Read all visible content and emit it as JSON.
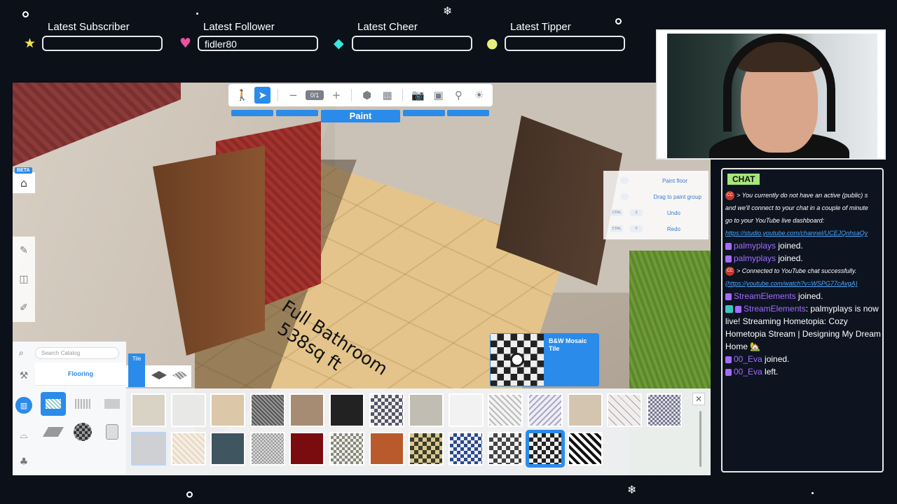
{
  "alerts": [
    {
      "label": "Latest Subscriber",
      "value": "",
      "icon": "★",
      "icon_color": "#f2e34b"
    },
    {
      "label": "Latest Follower",
      "value": "fidler80",
      "icon": "♥",
      "icon_color": "#ef4fa0"
    },
    {
      "label": "Latest Cheer",
      "value": "",
      "icon": "◆",
      "icon_color": "#39e6e0"
    },
    {
      "label": "Latest Tipper",
      "value": "",
      "icon": "●",
      "icon_color": "#e6f07a"
    }
  ],
  "game": {
    "toolbar": {
      "level": "0/1",
      "active_tab": "Paint"
    },
    "beta_badge": "BETA",
    "room_label_line1": "Full Bathroom",
    "room_label_line2": "538sq ft",
    "hotkeys": [
      {
        "keys": [
          "",
          ""
        ],
        "text": "Paint floor"
      },
      {
        "keys": [
          "",
          ""
        ],
        "text": "Drag to paint group"
      },
      {
        "keys": [
          "CTRL",
          "Z"
        ],
        "text": "Undo"
      },
      {
        "keys": [
          "CTRL",
          "Y"
        ],
        "text": "Redo"
      }
    ],
    "catalog": {
      "search_placeholder": "Search Catalog",
      "subcategory": "Flooring",
      "tile_tab": "Tile"
    },
    "selected_item": "B&W Mosaic Tile"
  },
  "chat": {
    "title": "CHAT",
    "messages": [
      {
        "type": "yt",
        "text": "> You currently do not have an active (public) s"
      },
      {
        "type": "sys",
        "text": "and we'll connect to your chat in a couple of minute"
      },
      {
        "type": "sys",
        "text": "go to your YouTube live dashboard:"
      },
      {
        "type": "link",
        "text": "https://studio.youtube.com/channel/UCEJQnhsaQy"
      },
      {
        "type": "tw",
        "user": "palmyplays",
        "text": " joined."
      },
      {
        "type": "tw",
        "user": "palmyplays",
        "text": " joined."
      },
      {
        "type": "yt",
        "text": "> Connected to YouTube chat successfully."
      },
      {
        "type": "link",
        "text": "(https://youtube.com/watch?v=WSPG77cAvgA)"
      },
      {
        "type": "tw",
        "user": "StreamElements",
        "text": " joined."
      },
      {
        "type": "se",
        "user": "StreamElements",
        "text": ": palmyplays is now live! Streaming Hometopia: Cozy Hometopia Stream | Designing My Dream Home 🏡"
      },
      {
        "type": "tw",
        "user": "00_Eva",
        "text": " joined."
      },
      {
        "type": "tw",
        "user": "00_Eva",
        "text": " left."
      }
    ]
  }
}
